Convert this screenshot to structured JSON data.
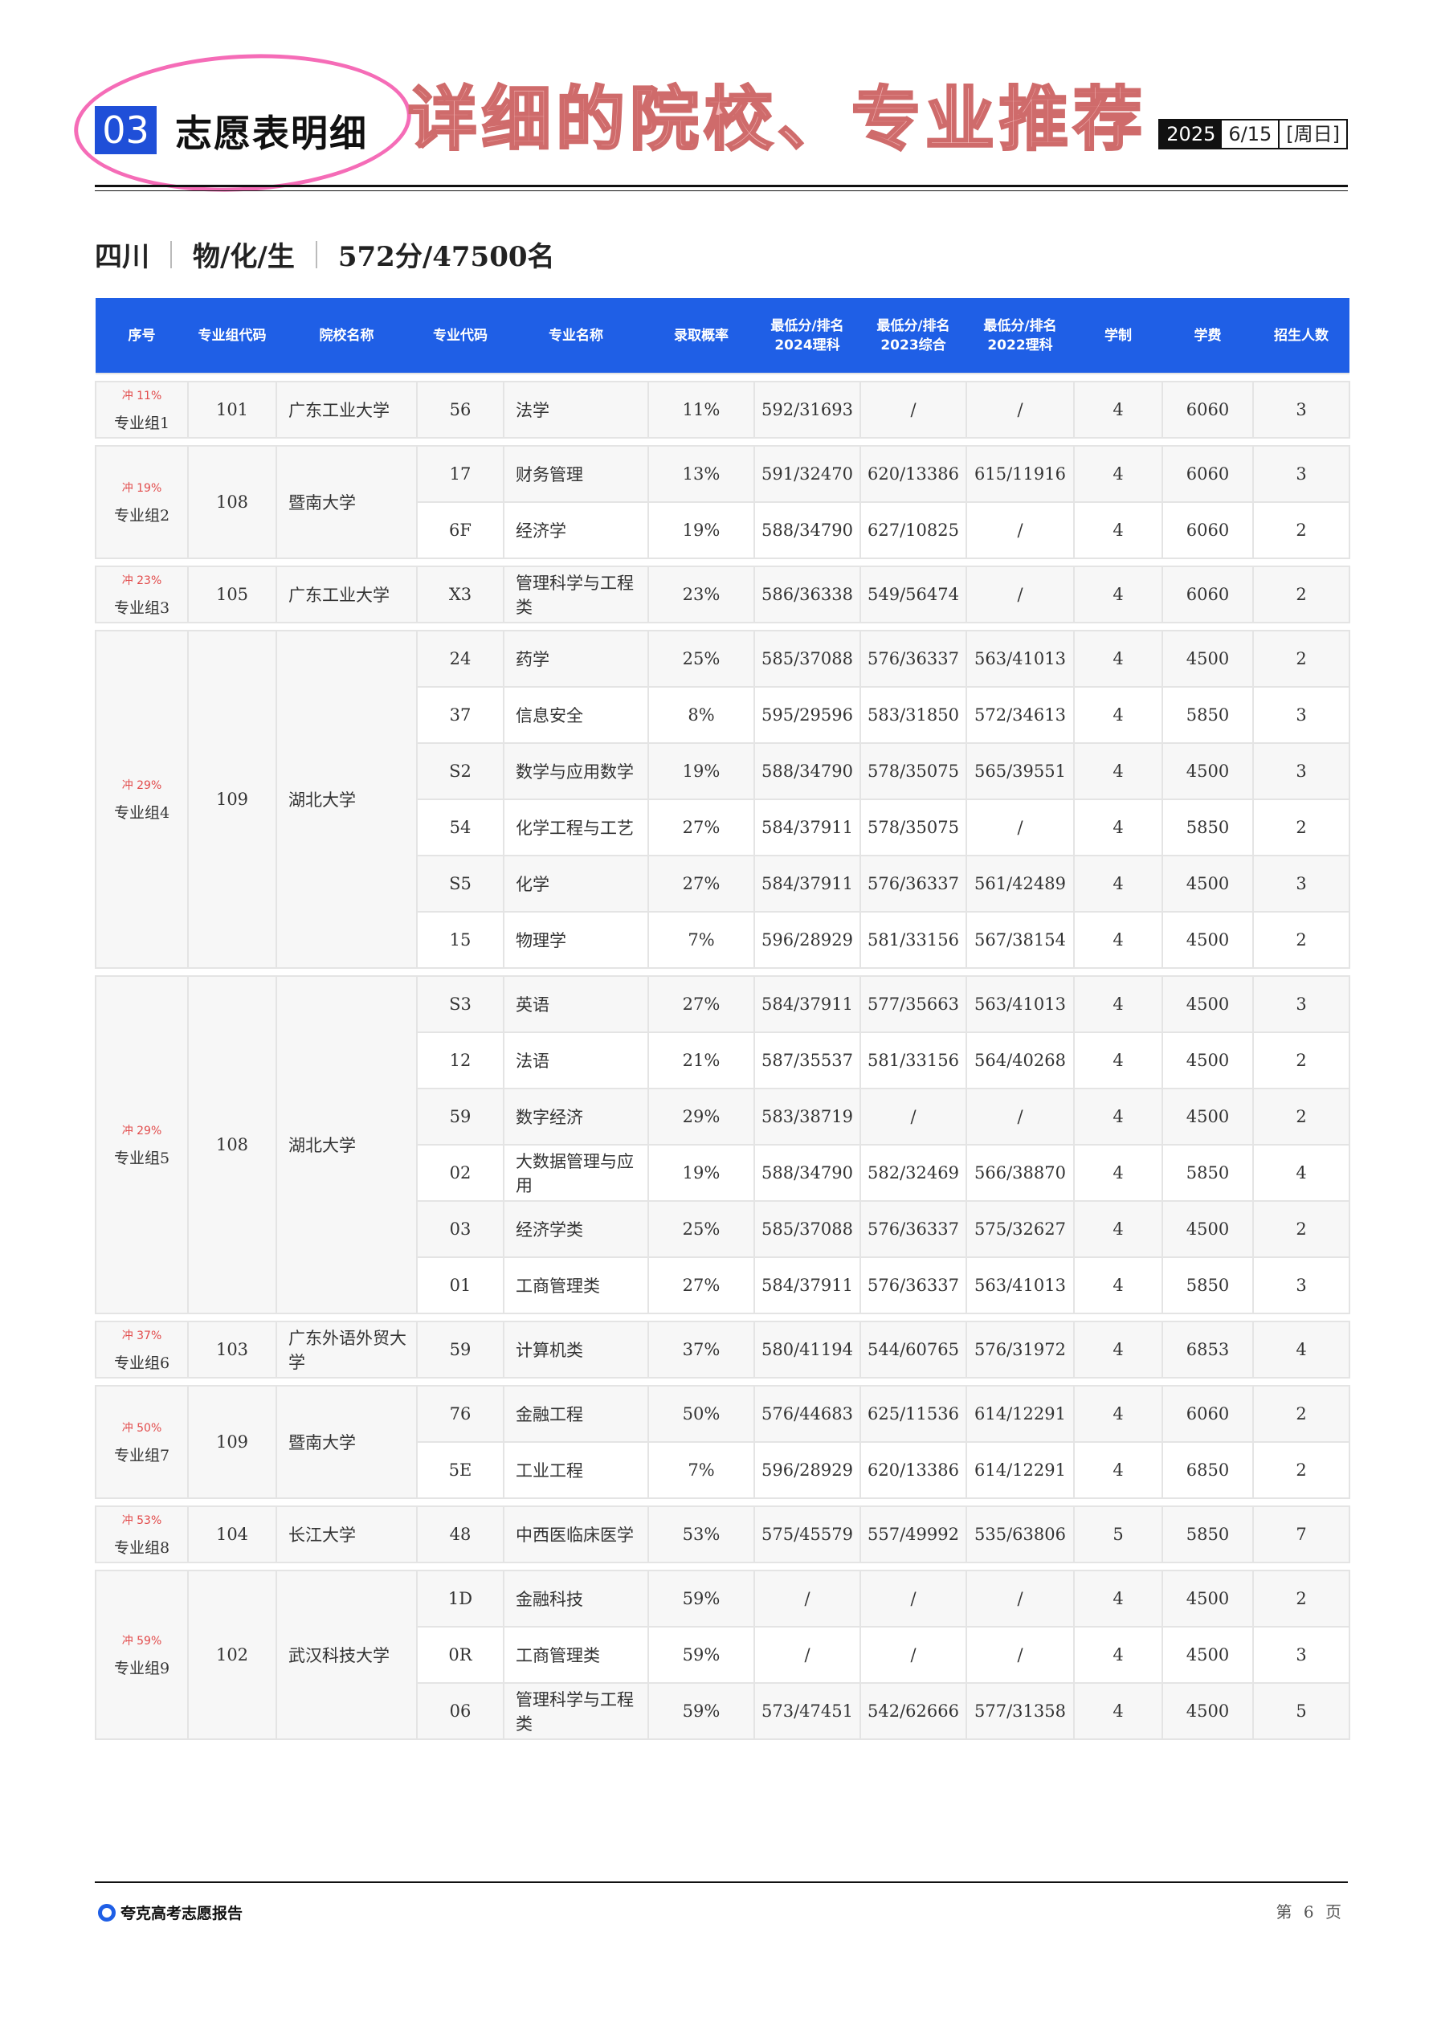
{
  "header": {
    "section_num": "03",
    "section_title": "志愿表明细",
    "handwritten": "详细的院校、专业推荐",
    "date_year": "2025",
    "date_md": "6/15",
    "date_weekday": "[周日]"
  },
  "meta": {
    "province": "四川",
    "subjects": "物/化/生",
    "score_rank": "572分/47500名"
  },
  "columns": [
    "序号",
    "专业组代码",
    "院校名称",
    "专业代码",
    "专业名称",
    "录取概率",
    [
      "最低分/排名",
      "2024理科"
    ],
    [
      "最低分/排名",
      "2023综合"
    ],
    [
      "最低分/排名",
      "2022理科"
    ],
    "学制",
    "学费",
    "招生人数"
  ],
  "groups": [
    {
      "rush": "冲 11%",
      "group": "专业组1",
      "code": "101",
      "school": "广东工业大学",
      "majors": [
        [
          "56",
          "法学",
          "11%",
          "592/31693",
          "/",
          "/",
          "4",
          "6060",
          "3"
        ]
      ]
    },
    {
      "rush": "冲 19%",
      "group": "专业组2",
      "code": "108",
      "school": "暨南大学",
      "majors": [
        [
          "17",
          "财务管理",
          "13%",
          "591/32470",
          "620/13386",
          "615/11916",
          "4",
          "6060",
          "3"
        ],
        [
          "6F",
          "经济学",
          "19%",
          "588/34790",
          "627/10825",
          "/",
          "4",
          "6060",
          "2"
        ]
      ]
    },
    {
      "rush": "冲 23%",
      "group": "专业组3",
      "code": "105",
      "school": "广东工业大学",
      "majors": [
        [
          "X3",
          "管理科学与工程类",
          "23%",
          "586/36338",
          "549/56474",
          "/",
          "4",
          "6060",
          "2"
        ]
      ]
    },
    {
      "rush": "冲 29%",
      "group": "专业组4",
      "code": "109",
      "school": "湖北大学",
      "majors": [
        [
          "24",
          "药学",
          "25%",
          "585/37088",
          "576/36337",
          "563/41013",
          "4",
          "4500",
          "2"
        ],
        [
          "37",
          "信息安全",
          "8%",
          "595/29596",
          "583/31850",
          "572/34613",
          "4",
          "5850",
          "3"
        ],
        [
          "S2",
          "数学与应用数学",
          "19%",
          "588/34790",
          "578/35075",
          "565/39551",
          "4",
          "4500",
          "3"
        ],
        [
          "54",
          "化学工程与工艺",
          "27%",
          "584/37911",
          "578/35075",
          "/",
          "4",
          "5850",
          "2"
        ],
        [
          "S5",
          "化学",
          "27%",
          "584/37911",
          "576/36337",
          "561/42489",
          "4",
          "4500",
          "3"
        ],
        [
          "15",
          "物理学",
          "7%",
          "596/28929",
          "581/33156",
          "567/38154",
          "4",
          "4500",
          "2"
        ]
      ]
    },
    {
      "rush": "冲 29%",
      "group": "专业组5",
      "code": "108",
      "school": "湖北大学",
      "majors": [
        [
          "S3",
          "英语",
          "27%",
          "584/37911",
          "577/35663",
          "563/41013",
          "4",
          "4500",
          "3"
        ],
        [
          "12",
          "法语",
          "21%",
          "587/35537",
          "581/33156",
          "564/40268",
          "4",
          "4500",
          "2"
        ],
        [
          "59",
          "数字经济",
          "29%",
          "583/38719",
          "/",
          "/",
          "4",
          "4500",
          "2"
        ],
        [
          "02",
          "大数据管理与应用",
          "19%",
          "588/34790",
          "582/32469",
          "566/38870",
          "4",
          "5850",
          "4"
        ],
        [
          "03",
          "经济学类",
          "25%",
          "585/37088",
          "576/36337",
          "575/32627",
          "4",
          "4500",
          "2"
        ],
        [
          "01",
          "工商管理类",
          "27%",
          "584/37911",
          "576/36337",
          "563/41013",
          "4",
          "5850",
          "3"
        ]
      ]
    },
    {
      "rush": "冲 37%",
      "group": "专业组6",
      "code": "103",
      "school": "广东外语外贸大学",
      "majors": [
        [
          "59",
          "计算机类",
          "37%",
          "580/41194",
          "544/60765",
          "576/31972",
          "4",
          "6853",
          "4"
        ]
      ]
    },
    {
      "rush": "冲 50%",
      "group": "专业组7",
      "code": "109",
      "school": "暨南大学",
      "majors": [
        [
          "76",
          "金融工程",
          "50%",
          "576/44683",
          "625/11536",
          "614/12291",
          "4",
          "6060",
          "2"
        ],
        [
          "5E",
          "工业工程",
          "7%",
          "596/28929",
          "620/13386",
          "614/12291",
          "4",
          "6850",
          "2"
        ]
      ]
    },
    {
      "rush": "冲 53%",
      "group": "专业组8",
      "code": "104",
      "school": "长江大学",
      "majors": [
        [
          "48",
          "中西医临床医学",
          "53%",
          "575/45579",
          "557/49992",
          "535/63806",
          "5",
          "5850",
          "7"
        ]
      ]
    },
    {
      "rush": "冲 59%",
      "group": "专业组9",
      "code": "102",
      "school": "武汉科技大学",
      "majors": [
        [
          "1D",
          "金融科技",
          "59%",
          "/",
          "/",
          "/",
          "4",
          "4500",
          "2"
        ],
        [
          "0R",
          "工商管理类",
          "59%",
          "/",
          "/",
          "/",
          "4",
          "4500",
          "3"
        ],
        [
          "06",
          "管理科学与工程类",
          "59%",
          "573/47451",
          "542/62666",
          "577/31358",
          "4",
          "4500",
          "5"
        ]
      ]
    }
  ],
  "footer": {
    "brand": "夸克高考志愿报告",
    "page_prefix": "第",
    "page_num": "6",
    "page_suffix": "页"
  }
}
